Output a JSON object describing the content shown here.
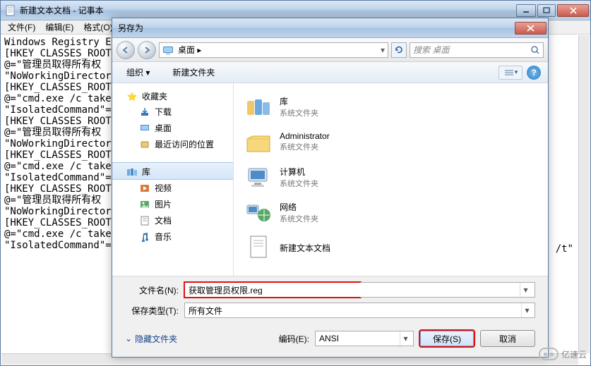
{
  "notepad": {
    "title": "新建文本文档 - 记事本",
    "menu": {
      "file": "文件(F)",
      "edit": "编辑(E)",
      "format": "格式(O)"
    },
    "body_fragment_rest": "/t\""
  },
  "notepad_lines": [
    "Windows Registry E",
    "[HKEY_CLASSES_ROOT",
    "@=\"管理员取得所有权",
    "\"NoWorkingDirector",
    "[HKEY_CLASSES_ROOT",
    "@=\"cmd.exe /c take",
    "\"IsolatedCommand\"=",
    "[HKEY_CLASSES_ROOT",
    "@=\"管理员取得所有权",
    "\"NoWorkingDirector",
    "[HKEY_CLASSES_ROOT",
    "@=\"cmd.exe /c take",
    "\"IsolatedCommand\"=",
    "[HKEY_CLASSES_ROOT",
    "@=\"管理员取得所有权",
    "\"NoWorkingDirector",
    "[HKEY_CLASSES_ROOT",
    "@=\"cmd.exe /c take",
    "\"IsolatedCommand\"="
  ],
  "saveas": {
    "title": "另存为",
    "breadcrumb": "桌面  ▸",
    "search_placeholder": "搜索 桌面",
    "toolbar": {
      "organize": "组织 ▾",
      "newfolder": "新建文件夹"
    },
    "nav": {
      "favorites": "收藏夹",
      "downloads": "下载",
      "desktop": "桌面",
      "recent": "最近访问的位置",
      "libraries": "库",
      "videos": "视频",
      "pictures": "图片",
      "documents": "文档",
      "music": "音乐"
    },
    "items": [
      {
        "name": "库",
        "sub": "系统文件夹"
      },
      {
        "name": "Administrator",
        "sub": "系统文件夹"
      },
      {
        "name": "计算机",
        "sub": "系统文件夹"
      },
      {
        "name": "网络",
        "sub": "系统文件夹"
      },
      {
        "name": "新建文本文档",
        "sub": ""
      }
    ],
    "filename_label": "文件名(N):",
    "filename_value": "获取管理员权限.reg",
    "filetype_label": "保存类型(T):",
    "filetype_value": "所有文件",
    "hide_folders": "隐藏文件夹",
    "encoding_label": "编码(E):",
    "encoding_value": "ANSI",
    "save": "保存(S)",
    "cancel": "取消"
  },
  "watermark": "亿速云"
}
